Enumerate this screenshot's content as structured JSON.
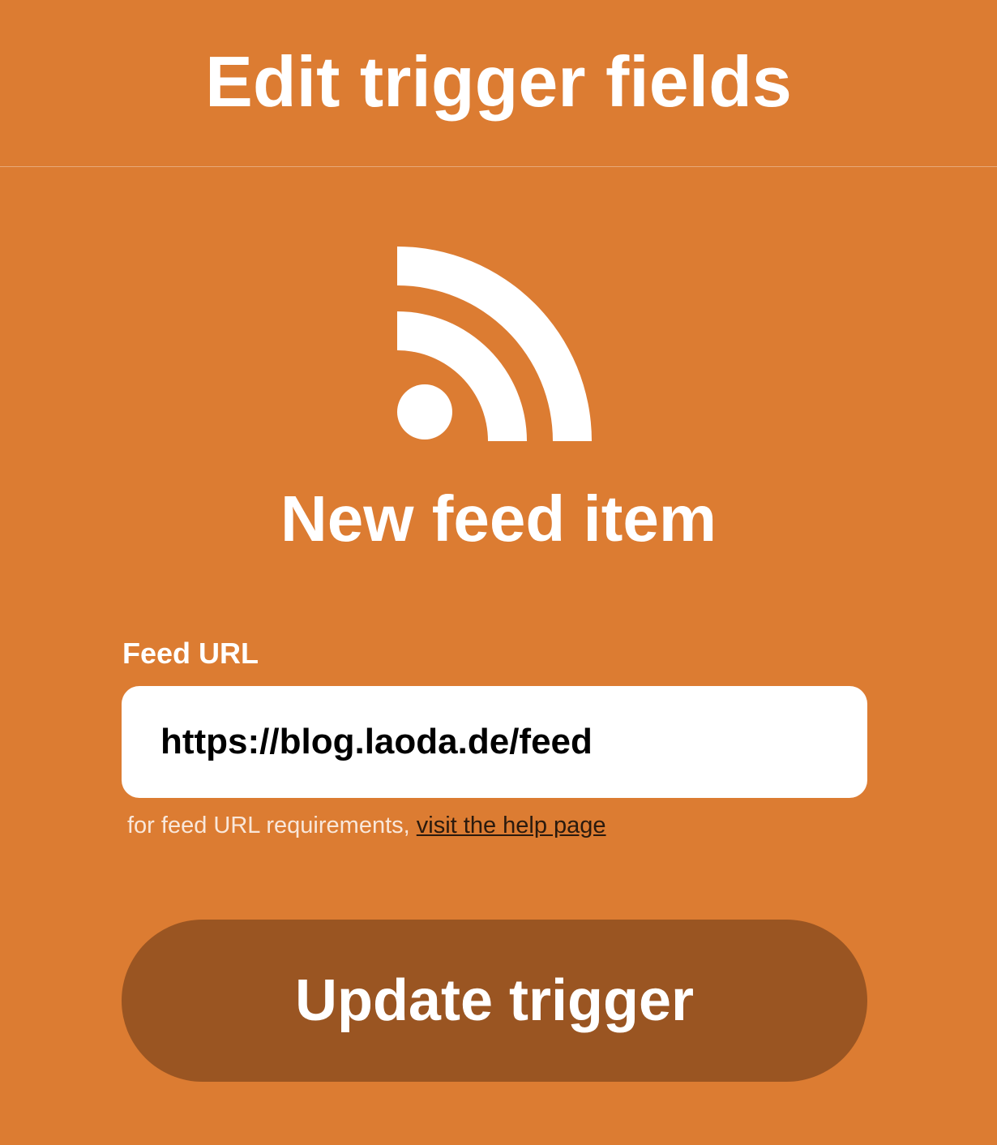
{
  "colors": {
    "background": "#DC7C32",
    "button": "#9A5522",
    "text": "#FFFFFF",
    "link": "#2A1A0E"
  },
  "header": {
    "title": "Edit trigger fields"
  },
  "trigger": {
    "icon": "rss-feed-icon",
    "name": "New feed item"
  },
  "field": {
    "label": "Feed URL",
    "value": "https://blog.laoda.de/feed",
    "help_prefix": "for feed URL requirements, ",
    "help_link": "visit the help page"
  },
  "actions": {
    "update_label": "Update trigger"
  }
}
